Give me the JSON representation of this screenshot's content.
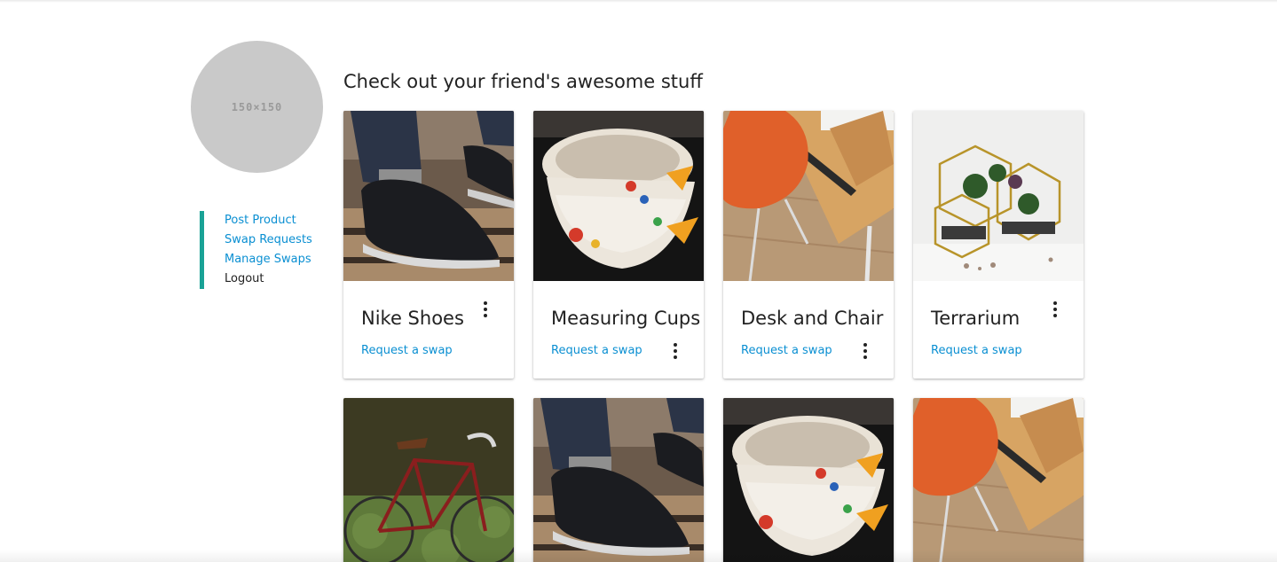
{
  "profile": {
    "avatar_text": "150×150"
  },
  "sidebar": {
    "items": [
      {
        "label": "Post Product"
      },
      {
        "label": "Swap Requests"
      },
      {
        "label": "Manage Swaps"
      },
      {
        "label": "Logout"
      }
    ]
  },
  "main": {
    "title": "Check out your friend's awesome stuff",
    "cards": [
      {
        "name": "Nike Shoes",
        "action": "Request a swap",
        "image": "shoe"
      },
      {
        "name": "Measuring Cups",
        "action": "Request a swap",
        "image": "cups"
      },
      {
        "name": "Desk and Chair",
        "action": "Request a swap",
        "image": "desk"
      },
      {
        "name": "Terrarium",
        "action": "Request a swap",
        "image": "terrarium"
      },
      {
        "image": "bicycle"
      },
      {
        "image": "shoe"
      },
      {
        "image": "cups"
      },
      {
        "image": "desk"
      }
    ]
  },
  "colors": {
    "accent": "#1aa296",
    "link": "#0a8fd2",
    "text": "#222222"
  }
}
